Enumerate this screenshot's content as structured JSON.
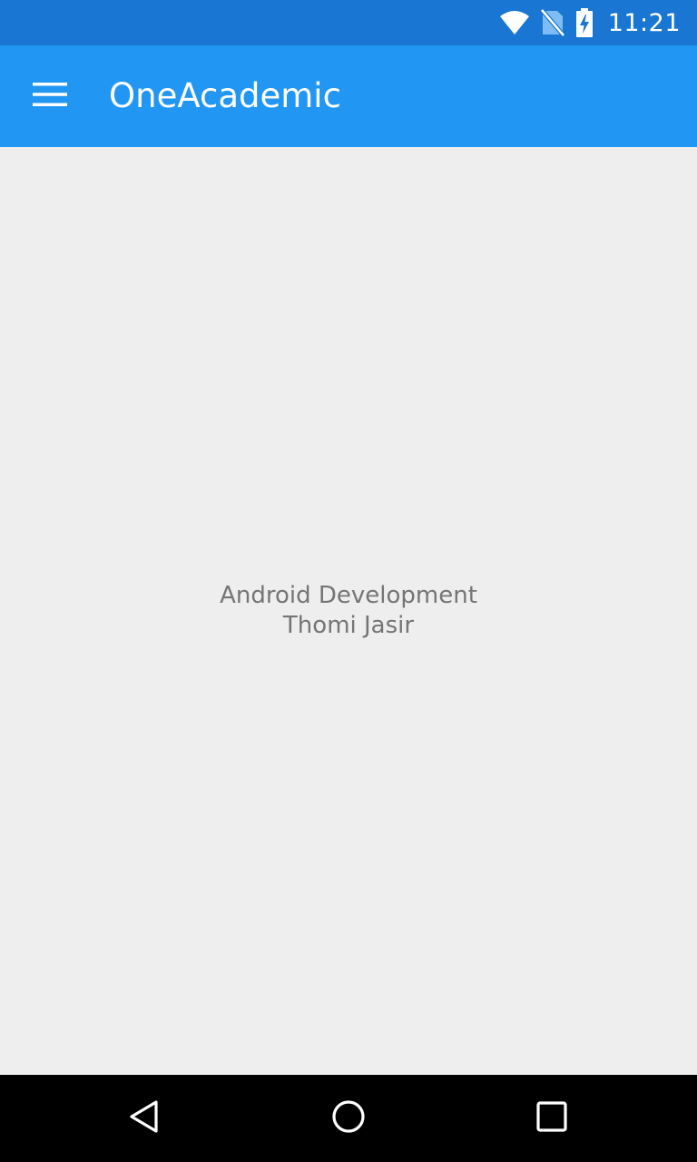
{
  "status_bar": {
    "time": "11:21",
    "icons": [
      "wifi-icon",
      "no-sim-icon",
      "battery-charging-icon"
    ],
    "color": "#1976d2"
  },
  "app_bar": {
    "title": "OneAcademic",
    "menu_icon": "hamburger-menu-icon",
    "color": "#2196f3"
  },
  "content": {
    "line1": "Android Development",
    "line2": "Thomi Jasir",
    "text_color": "#757575",
    "background": "#eeeeee"
  },
  "nav_bar": {
    "icons": [
      "back-icon",
      "home-icon",
      "recent-apps-icon"
    ]
  }
}
